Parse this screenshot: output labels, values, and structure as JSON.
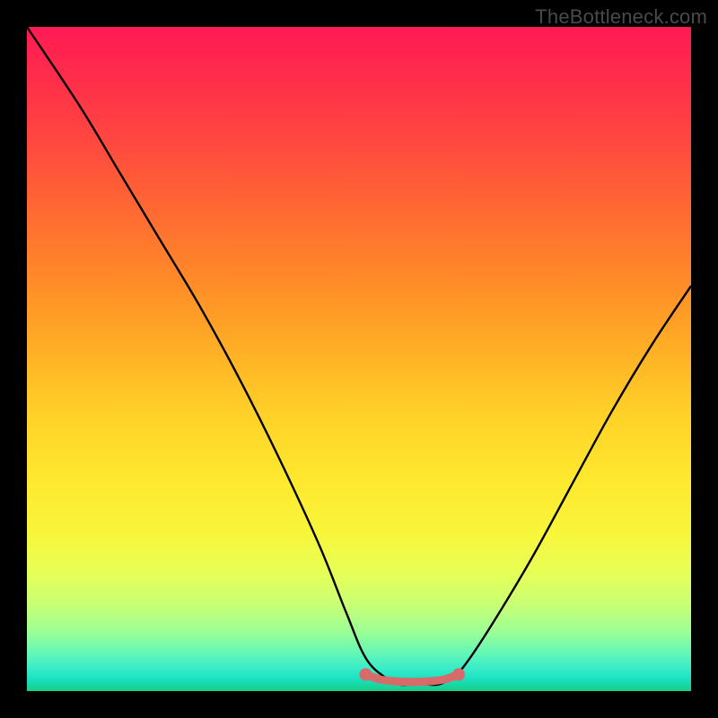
{
  "watermark": "TheBottleneck.com",
  "chart_data": {
    "type": "line",
    "title": "",
    "xlabel": "",
    "ylabel": "",
    "xlim": [
      0,
      100
    ],
    "ylim": [
      0,
      100
    ],
    "series": [
      {
        "name": "bottleneck-curve",
        "x": [
          0,
          8,
          14,
          20,
          26,
          32,
          38,
          44,
          48,
          51,
          54,
          56,
          58,
          60,
          62,
          64,
          66,
          70,
          76,
          82,
          88,
          94,
          100
        ],
        "values": [
          100,
          88,
          78,
          68,
          58,
          47,
          35,
          22,
          12,
          5,
          2,
          1,
          1,
          1,
          1,
          2,
          4,
          10,
          20,
          31,
          42,
          52,
          61
        ]
      },
      {
        "name": "flat-minimum-marker",
        "x": [
          51,
          53,
          55,
          57,
          59,
          61,
          63,
          65
        ],
        "values": [
          2.5,
          1.8,
          1.5,
          1.4,
          1.4,
          1.5,
          1.8,
          2.5
        ]
      }
    ],
    "marker_color": "#d86a6a",
    "curve_color": "#000000"
  }
}
